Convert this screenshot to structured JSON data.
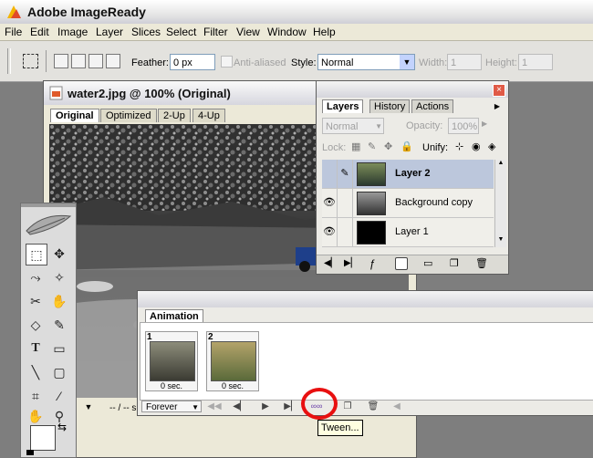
{
  "app": {
    "title": "Adobe ImageReady"
  },
  "menu": [
    "File",
    "Edit",
    "Image",
    "Layer",
    "Slices",
    "Select",
    "Filter",
    "View",
    "Window",
    "Help"
  ],
  "options": {
    "feather_label": "Feather:",
    "feather_value": "0 px",
    "antialiased_label": "Anti-aliased",
    "style_label": "Style:",
    "style_value": "Normal",
    "width_label": "Width:",
    "width_value": "1",
    "height_label": "Height:",
    "height_value": "1"
  },
  "document": {
    "title": "water2.jpg @ 100% (Original)",
    "tabs": [
      "Original",
      "Optimized",
      "2-Up",
      "4-Up"
    ],
    "status_loop": "Forever",
    "status_text": "-- / -- s"
  },
  "layers_panel": {
    "tabs": [
      "Layers",
      "History",
      "Actions"
    ],
    "blend_mode": "Normal",
    "opacity_label": "Opacity:",
    "opacity_value": "100%",
    "lock_label": "Lock:",
    "unify_label": "Unify:",
    "layers": [
      {
        "name": "Layer 2",
        "visible": false,
        "selected": true
      },
      {
        "name": "Background copy",
        "visible": true,
        "selected": false
      },
      {
        "name": "Layer 1",
        "visible": true,
        "selected": false
      }
    ]
  },
  "animation_panel": {
    "tab": "Animation",
    "frames": [
      {
        "number": "1",
        "delay": "0 sec."
      },
      {
        "number": "2",
        "delay": "0 sec."
      }
    ],
    "loop": "Forever",
    "tooltip": "Tween..."
  },
  "colors": {
    "selected_layer": "#bcc7dc",
    "highlight_circle": "#e81010",
    "tooltip_bg": "#ffffe1"
  }
}
